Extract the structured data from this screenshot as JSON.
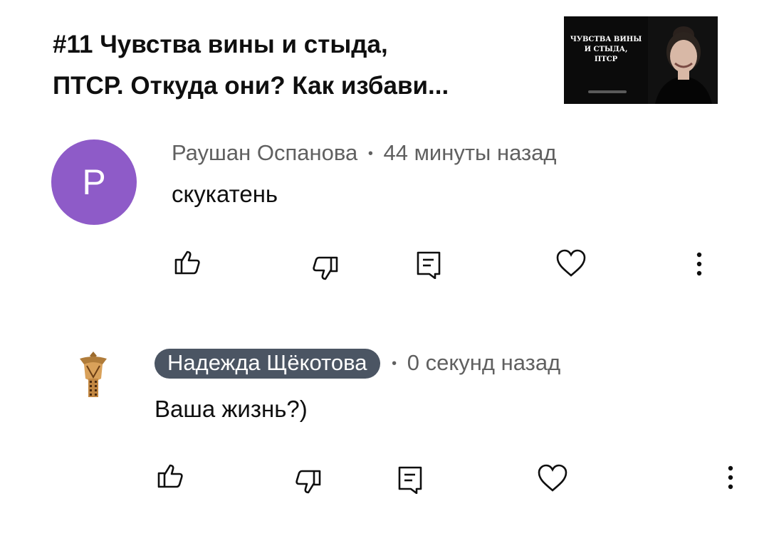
{
  "video": {
    "title_line1": "#11 Чувства вины и стыда,",
    "title_line2": "ПТСР. Откуда они? Как избави...",
    "thumbnail": {
      "line1": "ЧУВСТВА ВИНЫ",
      "line2": "И СТЫДА,",
      "line3": "ПТСР"
    }
  },
  "comments": [
    {
      "avatar_letter": "Р",
      "avatar_color": "#8e5bc8",
      "author": "Раушан Оспанова",
      "separator": "•",
      "time": "44 минуты назад",
      "text": "скукатень",
      "actions": [
        "like-icon",
        "dislike-icon",
        "reply-icon",
        "heart-icon",
        "more-icon"
      ]
    },
    {
      "avatar_icon": "ornament-bird-avatar",
      "author": "Надежда Щёкотова",
      "author_highlighted": true,
      "separator": "•",
      "time": "0 секунд назад",
      "text": "Ваша жизнь?)",
      "actions": [
        "like-icon",
        "dislike-icon",
        "reply-icon",
        "heart-icon",
        "more-icon"
      ]
    }
  ]
}
